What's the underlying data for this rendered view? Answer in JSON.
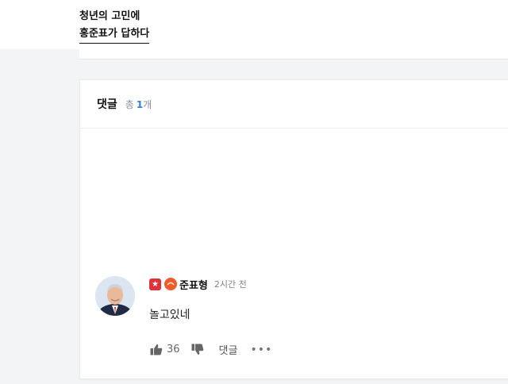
{
  "article": {
    "headline_line1": "청년의 고민에",
    "headline_line2": "홍준표가 답하다"
  },
  "comments_section": {
    "title": "댓글",
    "total_label": "총",
    "total_count": "1",
    "total_unit": "개"
  },
  "comment": {
    "author": "준표형",
    "time": "2시간 전",
    "text": "놀고있네",
    "likes": "36",
    "reply_label": "댓글",
    "more_label": "•••",
    "badge_star": "★"
  },
  "icons": {
    "like": "thumbs-up-icon",
    "dislike": "thumbs-down-icon",
    "more": "more-icon",
    "star_badge": "star-badge-icon",
    "party_badge": "party-badge-icon"
  },
  "colors": {
    "accent_count": "#2f7de1",
    "badge_red": "#e0323a",
    "badge_orange": "#f05a2e"
  }
}
